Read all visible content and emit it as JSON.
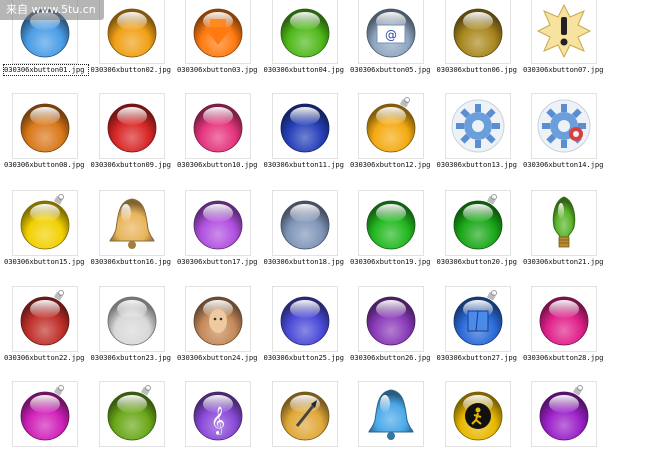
{
  "watermark": {
    "text": "来自 www.5tu.cn"
  },
  "files": [
    {
      "name": "030306xbutton01.jpg",
      "icon": "blue-glossy-orb",
      "color": "#4a9de6",
      "selected": true
    },
    {
      "name": "030306xbutton02.jpg",
      "icon": "orange-glossy-orb",
      "color": "#f0a015"
    },
    {
      "name": "030306xbutton03.jpg",
      "icon": "download-arrow-icon",
      "color": "#ff7a10"
    },
    {
      "name": "030306xbutton04.jpg",
      "icon": "green-swirl-orb",
      "color": "#4fb81a"
    },
    {
      "name": "030306xbutton05.jpg",
      "icon": "mail-at-icon",
      "color": "#8fa6c2"
    },
    {
      "name": "030306xbutton06.jpg",
      "icon": "olive-cloudy-orb",
      "color": "#a9871e"
    },
    {
      "name": "030306xbutton07.jpg",
      "icon": "exclamation-burst-icon",
      "color": "#f3d67a"
    },
    {
      "name": "030306xbutton08.jpg",
      "icon": "fire-orb",
      "color": "#d9781a"
    },
    {
      "name": "030306xbutton09.jpg",
      "icon": "red-wave-orb",
      "color": "#d82626"
    },
    {
      "name": "030306xbutton10.jpg",
      "icon": "pink-burst-orb",
      "color": "#e5347e"
    },
    {
      "name": "030306xbutton11.jpg",
      "icon": "blue-swirl-orb",
      "color": "#2540b8"
    },
    {
      "name": "030306xbutton12.jpg",
      "icon": "gold-ornament-orb",
      "color": "#f4aa10"
    },
    {
      "name": "030306xbutton13.jpg",
      "icon": "blue-gear-icon",
      "color": "#6a9fdc"
    },
    {
      "name": "030306xbutton14.jpg",
      "icon": "gears-orb-icon",
      "color": "#d84040"
    },
    {
      "name": "030306xbutton15.jpg",
      "icon": "yellow-ornament-orb",
      "color": "#f2d000"
    },
    {
      "name": "030306xbutton16.jpg",
      "icon": "gold-bell-icon",
      "color": "#e8b45a"
    },
    {
      "name": "030306xbutton17.jpg",
      "icon": "violet-glossy-orb",
      "color": "#b050e0"
    },
    {
      "name": "030306xbutton18.jpg",
      "icon": "steel-blue-orb",
      "color": "#7f95b8"
    },
    {
      "name": "030306xbutton19.jpg",
      "icon": "green-glossy-orb",
      "color": "#22b820"
    },
    {
      "name": "030306xbutton20.jpg",
      "icon": "green-ornament-orb",
      "color": "#1aa818"
    },
    {
      "name": "030306xbutton21.jpg",
      "icon": "green-bulb-icon",
      "color": "#5bb42a"
    },
    {
      "name": "030306xbutton22.jpg",
      "icon": "red-green-ornament-orb",
      "color": "#c0302a"
    },
    {
      "name": "030306xbutton23.jpg",
      "icon": "white-glossy-orb",
      "color": "#d8d8d8"
    },
    {
      "name": "030306xbutton24.jpg",
      "icon": "portrait-orb",
      "color": "#c58a5a"
    },
    {
      "name": "030306xbutton25.jpg",
      "icon": "indigo-glossy-orb",
      "color": "#4a4ad8"
    },
    {
      "name": "030306xbutton26.jpg",
      "icon": "nebula-orb",
      "color": "#8a3ab8"
    },
    {
      "name": "030306xbutton27.jpg",
      "icon": "finder-ornament-icon",
      "color": "#2a6ad8"
    },
    {
      "name": "030306xbutton28.jpg",
      "icon": "magenta-glossy-orb",
      "color": "#e0208a"
    },
    {
      "name": "",
      "icon": "magenta-ornament-orb",
      "color": "#d020b8"
    },
    {
      "name": "",
      "icon": "lime-ornament-orb",
      "color": "#6aa818"
    },
    {
      "name": "",
      "icon": "treble-clef-orb",
      "color": "#8a4ad8"
    },
    {
      "name": "",
      "icon": "paint-brush-orb",
      "color": "#e0a838"
    },
    {
      "name": "",
      "icon": "blue-bell-icon",
      "color": "#4aa8e8"
    },
    {
      "name": "",
      "icon": "walking-figure-orb",
      "color": "#e8b800"
    },
    {
      "name": "",
      "icon": "purple-ornament-orb",
      "color": "#9a20c8"
    }
  ]
}
